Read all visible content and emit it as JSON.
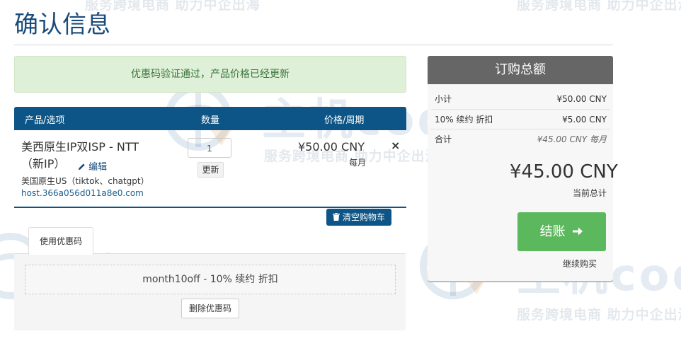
{
  "page": {
    "title": "确认信息"
  },
  "alert": {
    "text": "优惠码验证通过，产品价格已经更新"
  },
  "cart": {
    "headers": {
      "product": "产品/选项",
      "quantity": "数量",
      "price": "价格/周期"
    },
    "item": {
      "name_line1": "美西原生IP双ISP - NTT",
      "name_line2": "（新IP）",
      "edit_label": "编辑",
      "description": "美国原生US（tiktok、chatgpt）",
      "hostname": "host.366a056d011a8e0.com",
      "quantity": "1",
      "update_label": "更新",
      "price": "¥50.00 CNY",
      "period": "每月",
      "remove_symbol": "×"
    },
    "empty_cart_label": "清空购物车"
  },
  "promo": {
    "tab_label": "使用优惠码",
    "applied_code": "month10off - 10% 续约 折扣",
    "remove_label": "删除优惠码"
  },
  "summary": {
    "title": "订购总额",
    "rows": [
      {
        "label": "小计",
        "value": "¥50.00 CNY"
      },
      {
        "label": "10% 续约 折扣",
        "value": "¥5.00 CNY"
      },
      {
        "label": "合计",
        "value": "¥45.00 CNY 每月"
      }
    ],
    "total": "¥45.00 CNY",
    "total_caption": "当前总计",
    "checkout_label": "结账",
    "continue_label": "继续购买"
  },
  "watermark": {
    "brand": "主机codes",
    "slogan": "服务跨境电商 助力中企出海"
  },
  "colors": {
    "primary": "#0d5586",
    "success": "#5cb85c",
    "alert_bg": "#dff0d8",
    "summary_header": "#666666"
  }
}
